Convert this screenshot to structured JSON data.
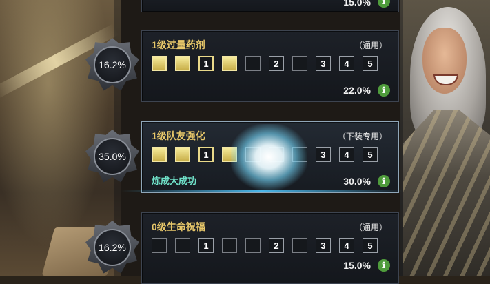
{
  "top_card": {
    "pct": "15.0%"
  },
  "cards": [
    {
      "emblem_pct": "16.2%",
      "title": "1级过量药剂",
      "tag": "（通用）",
      "slots": [
        "",
        "",
        "1",
        "",
        "",
        "2",
        "",
        "3",
        "4",
        "5"
      ],
      "pct": "22.0%"
    },
    {
      "emblem_pct": "35.0%",
      "title": "1级队友强化",
      "tag": "（下装专用）",
      "slots": [
        "",
        "",
        "1",
        "",
        "",
        "",
        "",
        "3",
        "4",
        "5"
      ],
      "success_text": "炼成大成功",
      "pct": "30.0%"
    },
    {
      "emblem_pct": "16.2%",
      "title": "0级生命祝福",
      "tag": "（通用）",
      "slots": [
        "",
        "",
        "1",
        "",
        "",
        "2",
        "",
        "3",
        "4",
        "5"
      ],
      "pct": "15.0%"
    }
  ],
  "info_icon": "info-icon",
  "colors": {
    "title": "#e8c86a",
    "success": "#6fe0c8",
    "info": "#4f9c3c",
    "slot_filled": "#e9d98a"
  }
}
